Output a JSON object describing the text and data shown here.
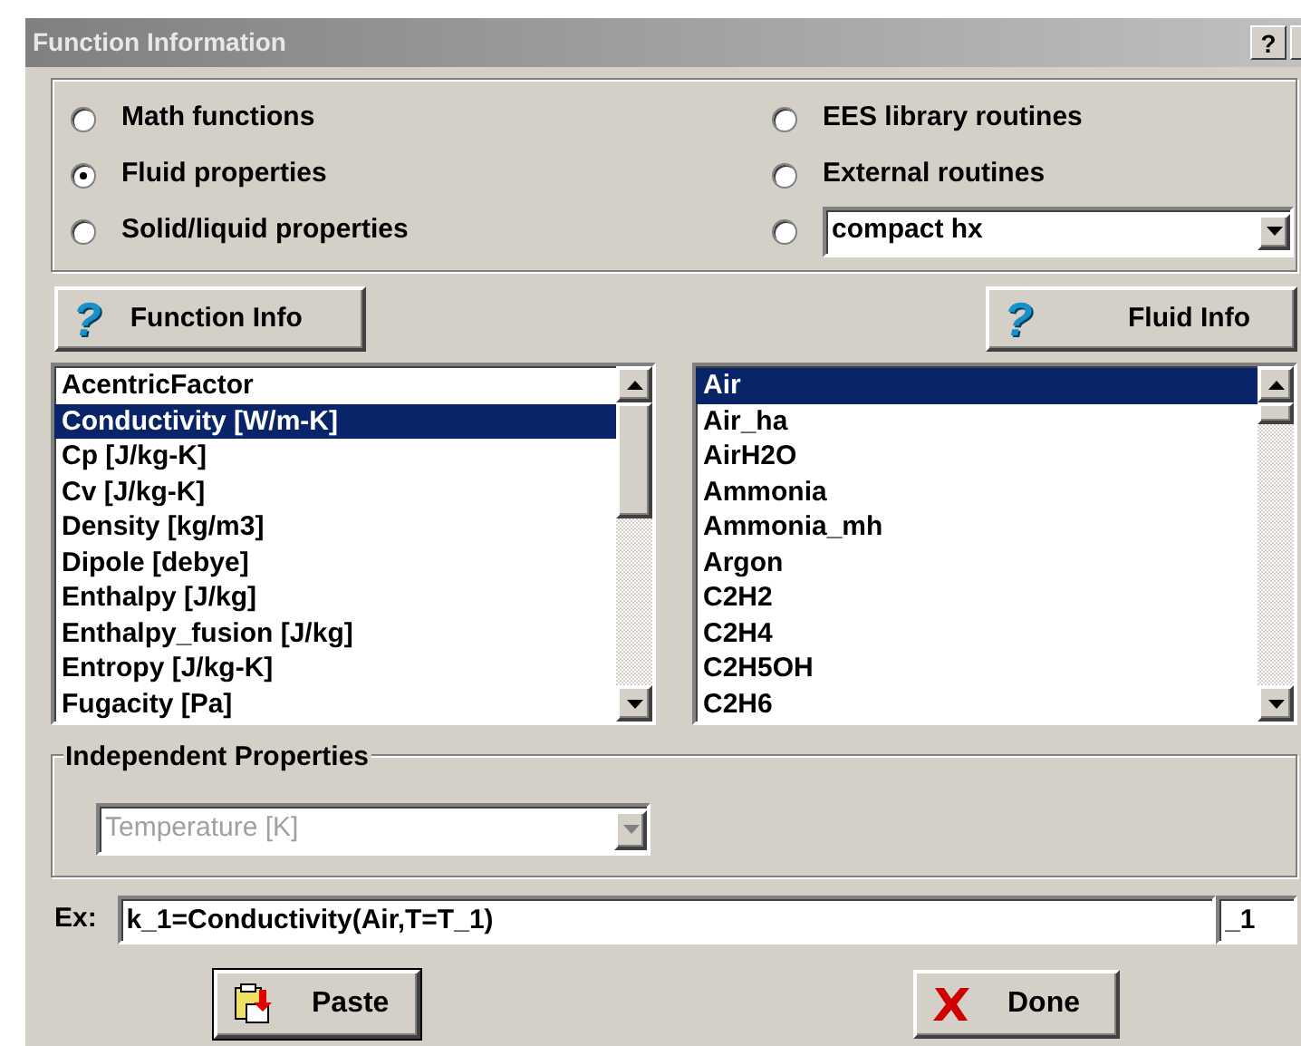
{
  "window": {
    "title": "Function Information",
    "help_button": "?"
  },
  "categories": [
    {
      "label": "Math functions",
      "selected": false
    },
    {
      "label": "Fluid properties",
      "selected": true
    },
    {
      "label": "Solid/liquid properties",
      "selected": false
    },
    {
      "label": "EES library routines",
      "selected": false
    },
    {
      "label": "External routines",
      "selected": false
    }
  ],
  "library_combo": {
    "value": "compact hx",
    "selected": false
  },
  "info_buttons": [
    {
      "icon": "?",
      "label": "Function Info"
    },
    {
      "icon": "?",
      "label": "Fluid Info"
    }
  ],
  "functions": [
    {
      "label": "AcentricFactor",
      "selected": false
    },
    {
      "label": "Conductivity [W/m-K]",
      "selected": true
    },
    {
      "label": "Cp  [J/kg-K]",
      "selected": false
    },
    {
      "label": "Cv  [J/kg-K]",
      "selected": false
    },
    {
      "label": "Density [kg/m3]",
      "selected": false
    },
    {
      "label": "Dipole [debye]",
      "selected": false
    },
    {
      "label": "Enthalpy  [J/kg]",
      "selected": false
    },
    {
      "label": "Enthalpy_fusion  [J/kg]",
      "selected": false
    },
    {
      "label": "Entropy  [J/kg-K]",
      "selected": false
    },
    {
      "label": "Fugacity [Pa]",
      "selected": false
    }
  ],
  "fluids": [
    {
      "label": "Air",
      "selected": true
    },
    {
      "label": "Air_ha",
      "selected": false
    },
    {
      "label": "AirH2O",
      "selected": false
    },
    {
      "label": "Ammonia",
      "selected": false
    },
    {
      "label": "Ammonia_mh",
      "selected": false
    },
    {
      "label": "Argon",
      "selected": false
    },
    {
      "label": "C2H2",
      "selected": false
    },
    {
      "label": "C2H4",
      "selected": false
    },
    {
      "label": "C2H5OH",
      "selected": false
    },
    {
      "label": "C2H6",
      "selected": false
    }
  ],
  "independent_properties": {
    "legend": "Independent Properties",
    "value": "Temperature [K]",
    "disabled": true
  },
  "example": {
    "label": "Ex:",
    "value": "k_1=Conductivity(Air,T=T_1)",
    "suffix": "_1"
  },
  "buttons": [
    {
      "kind": "paste",
      "label": "Paste"
    },
    {
      "kind": "done",
      "label": "Done"
    }
  ]
}
